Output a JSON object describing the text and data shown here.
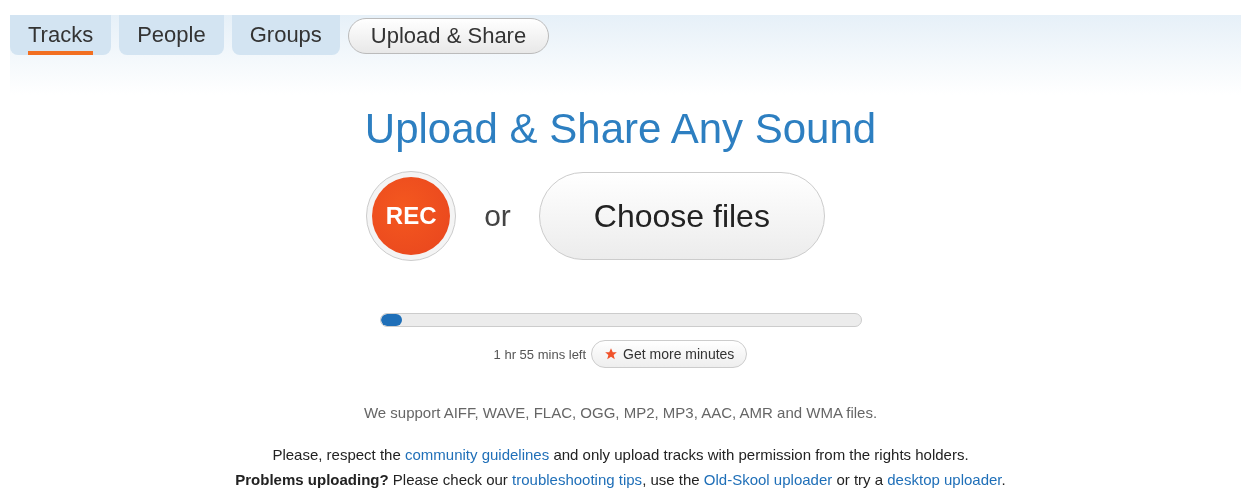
{
  "nav": [
    {
      "kind": "tab",
      "label": "Tracks",
      "selected": true
    },
    {
      "kind": "tab",
      "label": "People",
      "selected": false
    },
    {
      "kind": "tab",
      "label": "Groups",
      "selected": false
    },
    {
      "kind": "pill",
      "label": "Upload & Share"
    }
  ],
  "title": "Upload & Share Any Sound",
  "record_button": "REC",
  "or_text": "or",
  "choose_button": "Choose files",
  "quota": {
    "level": 0.045,
    "remaining": "1 hr 55 mins left",
    "more_button": "Get more minutes"
  },
  "formats_note": "We support AIFF, WAVE, FLAC, OGG, MP2, MP3, AAC, AMR and WMA files.",
  "notes": [
    [
      {
        "kind": "text",
        "text": "Please, respect the "
      },
      {
        "kind": "link",
        "text": "community guidelines"
      },
      {
        "kind": "text",
        "text": " and only upload tracks with permission from the rights holders."
      }
    ],
    [
      {
        "kind": "text",
        "text": "**Problems uploading?** Please check our "
      },
      {
        "kind": "link",
        "text": "troubleshooting tips"
      },
      {
        "kind": "text",
        "text": ", use the "
      },
      {
        "kind": "link",
        "text": "Old-Skool uploader"
      },
      {
        "kind": "text",
        "text": " or try a "
      },
      {
        "kind": "link",
        "text": "desktop uploader"
      },
      {
        "kind": "text",
        "text": "."
      }
    ]
  ]
}
